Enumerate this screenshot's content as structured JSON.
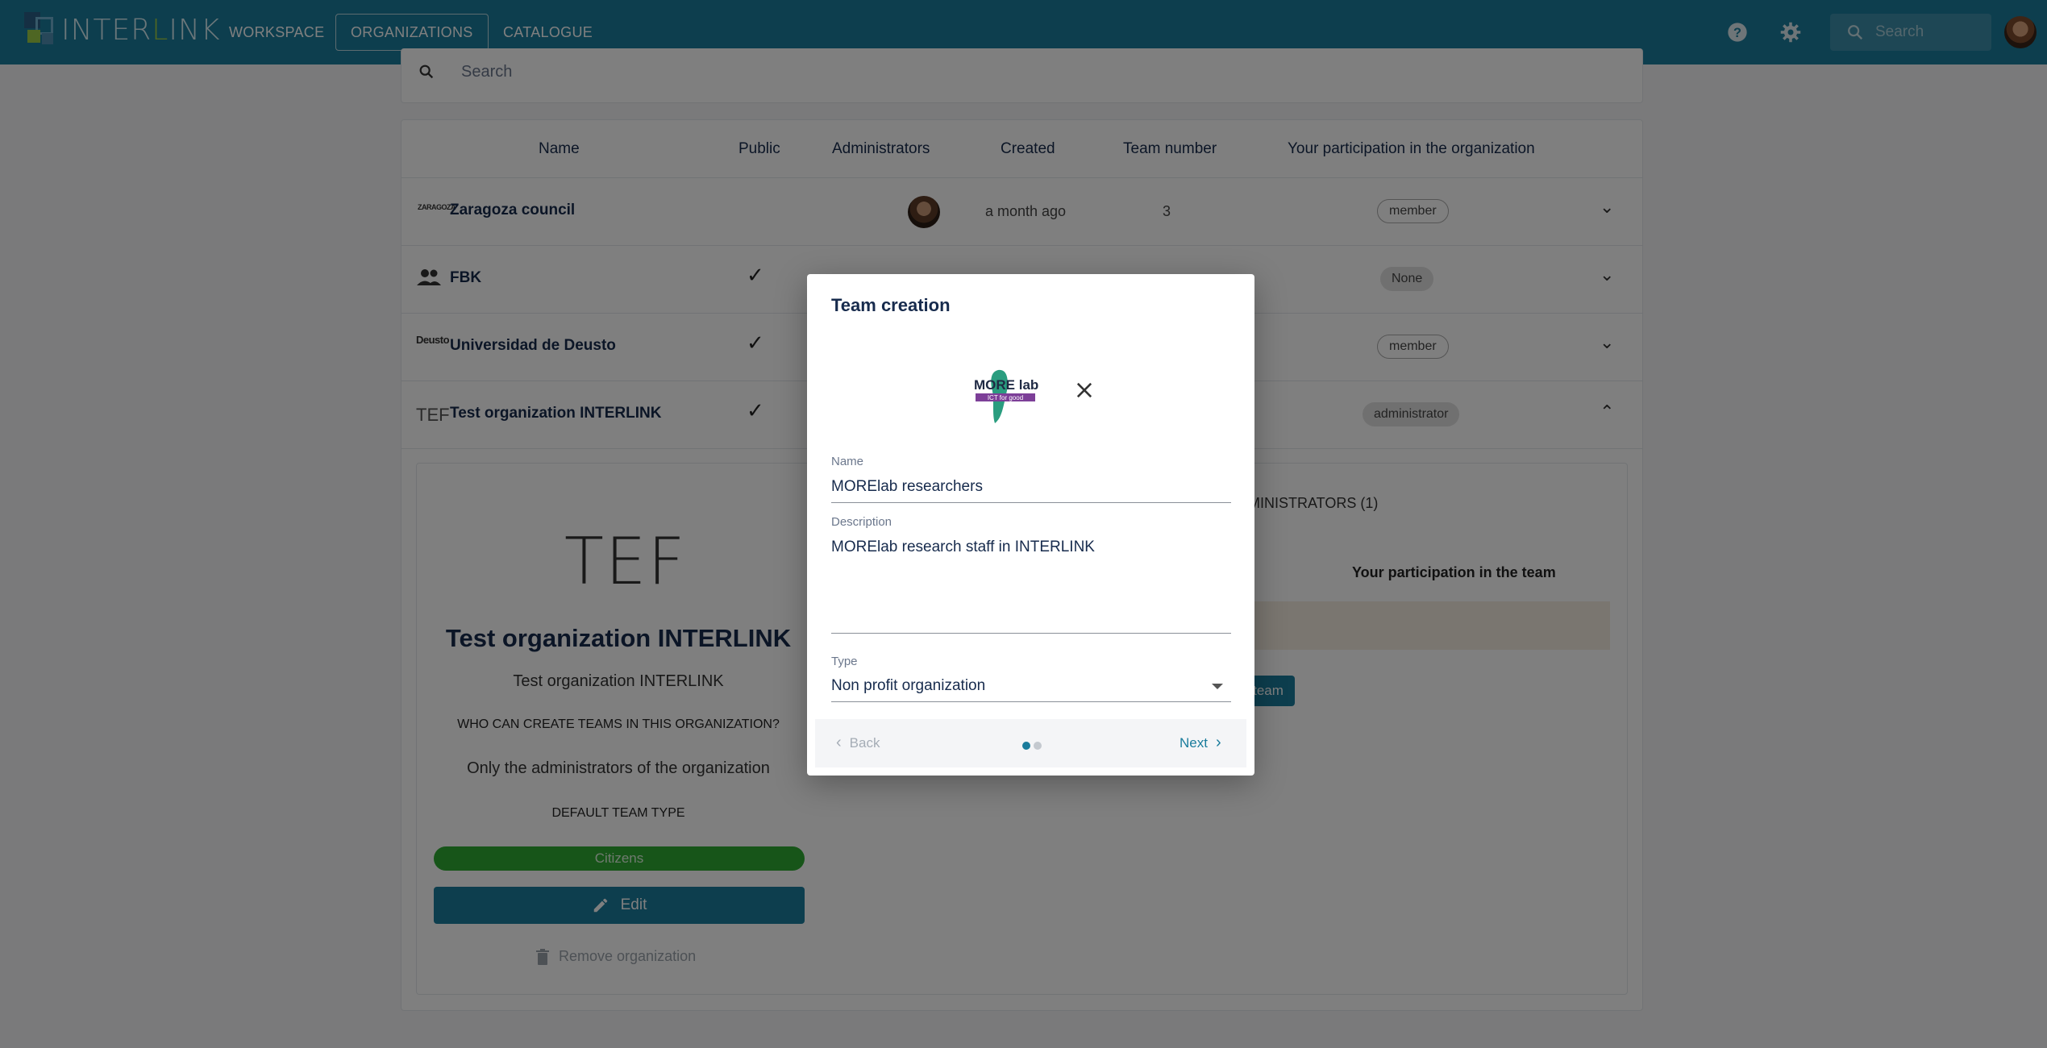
{
  "topbar": {
    "brand": "INTERLINK",
    "brand_accent_letter": "L",
    "nav": [
      "WORKSPACE",
      "ORGANIZATIONS",
      "CATALOGUE"
    ],
    "active_nav": "ORGANIZATIONS",
    "search_placeholder": "Search",
    "icons": [
      "help-icon",
      "settings-icon",
      "search-icon"
    ]
  },
  "search": {
    "placeholder": "Search"
  },
  "table": {
    "headers": [
      "Name",
      "Public",
      "Administrators",
      "Created",
      "Team number",
      "Your participation in the organization"
    ],
    "rows": [
      {
        "icon_text": "ZARAGOZA",
        "name": "Zaragoza council",
        "public": false,
        "created": "a month ago",
        "teams": "3",
        "participation": "member"
      },
      {
        "icon_text": "",
        "name": "FBK",
        "public": true,
        "created": "",
        "teams": "",
        "participation": "None"
      },
      {
        "icon_text": "Deusto",
        "name": "Universidad de Deusto",
        "public": true,
        "created": "",
        "teams": "",
        "participation": "member"
      },
      {
        "icon_text": "TEF",
        "name": "Test organization INTERLINK",
        "public": true,
        "created": "",
        "teams": "",
        "participation": "administrator"
      }
    ]
  },
  "detail": {
    "logo_text": "TEF",
    "title": "Test organization INTERLINK",
    "subtitle": "Test organization INTERLINK",
    "who_heading": "WHO CAN CREATE TEAMS IN THIS ORGANIZATION?",
    "who_value": "Only the administrators of the organization",
    "default_heading": "DEFAULT TEAM TYPE",
    "default_value": "Citizens",
    "edit_label": "Edit",
    "remove_label": "Remove organization",
    "admins_tab": "MINISTRATORS (1)",
    "participation_header": "Your participation in the team",
    "team_button": "team"
  },
  "modal": {
    "title": "Team creation",
    "logo_text": "MORE lab",
    "logo_tagline": "ICT for good",
    "name_label": "Name",
    "name_value": "MORElab researchers",
    "description_label": "Description",
    "description_value": "MORElab research staff in INTERLINK",
    "type_label": "Type",
    "type_value": "Non profit organization",
    "back_label": "Back",
    "next_label": "Next",
    "step_current": 1,
    "step_total": 2
  },
  "colors": {
    "primary": "#1a7c9c",
    "accent_green": "#2eaa32",
    "brand_green": "#9ccc47"
  }
}
